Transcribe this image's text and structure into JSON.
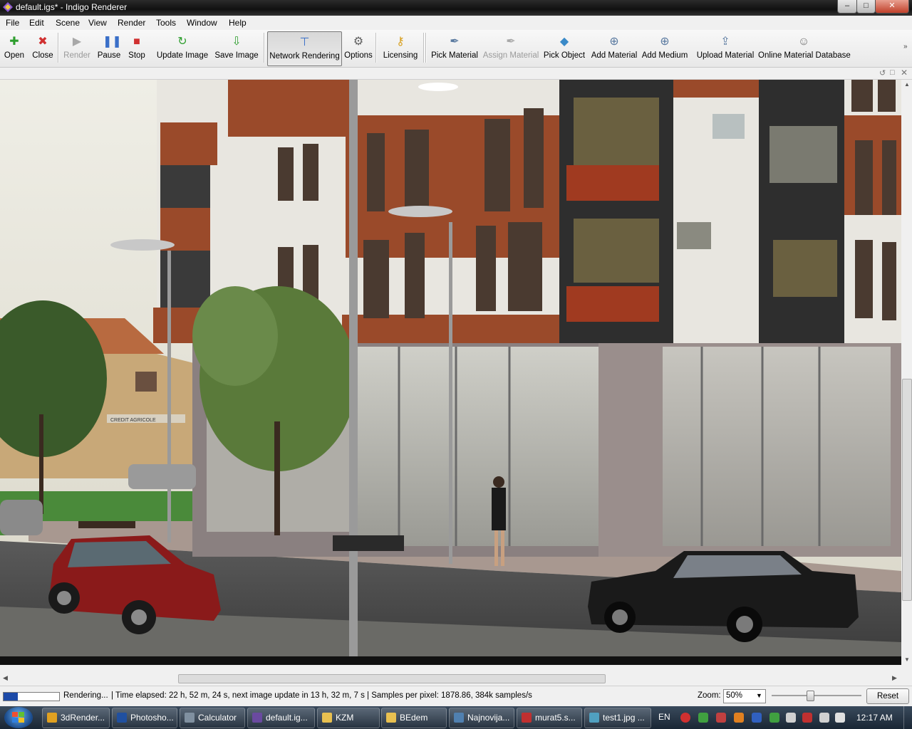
{
  "window": {
    "title": "default.igs* - Indigo Renderer",
    "minimize": "–",
    "maximize": "□",
    "close": "✕"
  },
  "menu": [
    "File",
    "Edit",
    "Scene",
    "View",
    "Render",
    "Tools",
    "Window",
    "Help"
  ],
  "toolbar": [
    {
      "label": "Open",
      "icon": "plus-icon",
      "glyph": "✚",
      "color": "#2e9e2e",
      "disabled": false
    },
    {
      "label": "Close",
      "icon": "close-x-icon",
      "glyph": "✖",
      "color": "#d03030",
      "disabled": false
    },
    {
      "label": "Render",
      "icon": "play-icon",
      "glyph": "▶",
      "color": "#a8a8a8",
      "disabled": true
    },
    {
      "label": "Pause",
      "icon": "pause-icon",
      "glyph": "❚❚",
      "color": "#3a6fc8",
      "disabled": false
    },
    {
      "label": "Stop",
      "icon": "stop-icon",
      "glyph": "■",
      "color": "#d03030",
      "disabled": false
    },
    {
      "label": "Update Image",
      "icon": "refresh-icon",
      "glyph": "↻",
      "color": "#2e9e2e",
      "disabled": false
    },
    {
      "label": "Save Image",
      "icon": "save-download-icon",
      "glyph": "⇩",
      "color": "#2e9e2e",
      "disabled": false
    },
    {
      "label": "Network Rendering",
      "icon": "network-icon",
      "glyph": "⊤",
      "color": "#3a6fc8",
      "disabled": false,
      "active": true
    },
    {
      "label": "Options",
      "icon": "gear-icon",
      "glyph": "⚙",
      "color": "#606060",
      "disabled": false
    },
    {
      "label": "Licensing",
      "icon": "key-icon",
      "glyph": "⚷",
      "color": "#d8a020",
      "disabled": false
    },
    {
      "label": "Pick Material",
      "icon": "pick-material-icon",
      "glyph": "✒",
      "color": "#5a7aa0",
      "disabled": false
    },
    {
      "label": "Assign Material",
      "icon": "assign-material-icon",
      "glyph": "✒",
      "color": "#a8a8a8",
      "disabled": true
    },
    {
      "label": "Pick Object",
      "icon": "pick-object-icon",
      "glyph": "◆",
      "color": "#3a8ac8",
      "disabled": false
    },
    {
      "label": "Add Material",
      "icon": "add-material-icon",
      "glyph": "⊕",
      "color": "#5a7aa0",
      "disabled": false
    },
    {
      "label": "Add Medium",
      "icon": "add-medium-icon",
      "glyph": "⊕",
      "color": "#5a7aa0",
      "disabled": false
    },
    {
      "label": "Upload Material",
      "icon": "upload-icon",
      "glyph": "⇪",
      "color": "#5a7aa0",
      "disabled": false
    },
    {
      "label": "Online Material Database",
      "icon": "database-icon",
      "glyph": "☺",
      "color": "#707070",
      "disabled": false
    }
  ],
  "status": {
    "state": "Rendering...",
    "info": "| Time elapsed: 22 h, 52 m, 24 s, next image update in 13 h, 32 m, 7 s | Samples per pixel: 1878.86, 384k samples/s",
    "progress": 0.25,
    "zoom_label": "Zoom:",
    "zoom_value": "50%",
    "zoom_slider": 0.42,
    "reset": "Reset"
  },
  "render_scene": {
    "sign_text": "CREDIT AGRICOLE"
  },
  "taskbar": {
    "items": [
      {
        "label": "3dRender...",
        "icon": "chrome-icon",
        "color": "#e0a020"
      },
      {
        "label": "Photosho...",
        "icon": "photoshop-icon",
        "color": "#2050a0"
      },
      {
        "label": "Calculator",
        "icon": "calculator-icon",
        "color": "#8090a0"
      },
      {
        "label": "default.ig...",
        "icon": "indigo-icon",
        "color": "#6a4aa0"
      },
      {
        "label": "KZM",
        "icon": "folder-icon",
        "color": "#e8c050"
      },
      {
        "label": "BEdem",
        "icon": "folder-icon",
        "color": "#e8c050"
      },
      {
        "label": "Najnovija...",
        "icon": "window-icon",
        "color": "#5080b0"
      },
      {
        "label": "murat5.s...",
        "icon": "sketchup-icon",
        "color": "#c03030"
      },
      {
        "label": "test1.jpg ...",
        "icon": "image-viewer-icon",
        "color": "#50a0c0"
      }
    ],
    "lang": "EN",
    "clock": "12:17 AM"
  }
}
